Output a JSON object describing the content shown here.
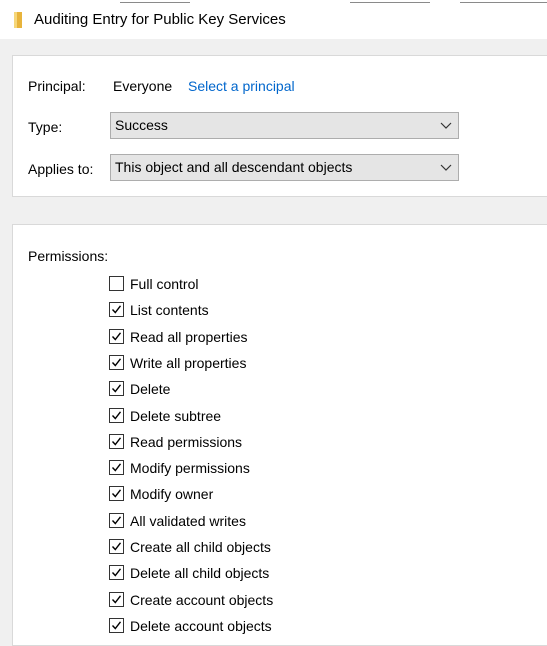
{
  "window": {
    "title": "Auditing Entry for Public Key Services"
  },
  "principal": {
    "label": "Principal:",
    "value": "Everyone",
    "link": "Select a principal"
  },
  "type": {
    "label": "Type:",
    "selected": "Success"
  },
  "applies_to": {
    "label": "Applies to:",
    "selected": "This object and all descendant objects"
  },
  "permissions": {
    "label": "Permissions:",
    "items": [
      {
        "label": "Full control",
        "checked": false
      },
      {
        "label": "List contents",
        "checked": true
      },
      {
        "label": "Read all properties",
        "checked": true
      },
      {
        "label": "Write all properties",
        "checked": true
      },
      {
        "label": "Delete",
        "checked": true
      },
      {
        "label": "Delete subtree",
        "checked": true
      },
      {
        "label": "Read permissions",
        "checked": true
      },
      {
        "label": "Modify permissions",
        "checked": true
      },
      {
        "label": "Modify owner",
        "checked": true
      },
      {
        "label": "All validated writes",
        "checked": true
      },
      {
        "label": "Create all child objects",
        "checked": true
      },
      {
        "label": "Delete all child objects",
        "checked": true
      },
      {
        "label": "Create account objects",
        "checked": true
      },
      {
        "label": "Delete account objects",
        "checked": true
      }
    ]
  },
  "colors": {
    "link": "#0066cc",
    "folder": "#e8b43c",
    "dropdown_bg": "#e5e5e5"
  }
}
